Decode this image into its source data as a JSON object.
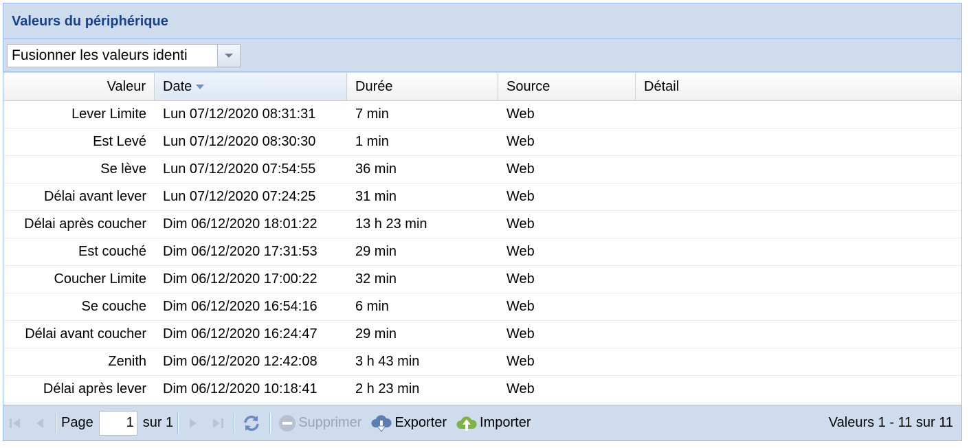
{
  "panel": {
    "title": "Valeurs du périphérique"
  },
  "combo": {
    "value": "Fusionner les valeurs identi"
  },
  "columns": {
    "valeur": "Valeur",
    "date": "Date",
    "duree": "Durée",
    "source": "Source",
    "detail": "Détail"
  },
  "rows": [
    {
      "valeur": "Lever Limite",
      "date": "Lun 07/12/2020 08:31:31",
      "duree": "7 min",
      "source": "Web",
      "detail": ""
    },
    {
      "valeur": "Est Levé",
      "date": "Lun 07/12/2020 08:30:30",
      "duree": "1 min",
      "source": "Web",
      "detail": ""
    },
    {
      "valeur": "Se lève",
      "date": "Lun 07/12/2020 07:54:55",
      "duree": "36 min",
      "source": "Web",
      "detail": ""
    },
    {
      "valeur": "Délai avant lever",
      "date": "Lun 07/12/2020 07:24:25",
      "duree": "31 min",
      "source": "Web",
      "detail": ""
    },
    {
      "valeur": "Délai après coucher",
      "date": "Dim 06/12/2020 18:01:22",
      "duree": "13 h 23 min",
      "source": "Web",
      "detail": ""
    },
    {
      "valeur": "Est couché",
      "date": "Dim 06/12/2020 17:31:53",
      "duree": "29 min",
      "source": "Web",
      "detail": ""
    },
    {
      "valeur": "Coucher Limite",
      "date": "Dim 06/12/2020 17:00:22",
      "duree": "32 min",
      "source": "Web",
      "detail": ""
    },
    {
      "valeur": "Se couche",
      "date": "Dim 06/12/2020 16:54:16",
      "duree": "6 min",
      "source": "Web",
      "detail": ""
    },
    {
      "valeur": "Délai avant coucher",
      "date": "Dim 06/12/2020 16:24:47",
      "duree": "29 min",
      "source": "Web",
      "detail": ""
    },
    {
      "valeur": "Zenith",
      "date": "Dim 06/12/2020 12:42:08",
      "duree": "3 h 43 min",
      "source": "Web",
      "detail": ""
    },
    {
      "valeur": "Délai après lever",
      "date": "Dim 06/12/2020 10:18:41",
      "duree": "2 h 23 min",
      "source": "Web",
      "detail": ""
    }
  ],
  "paging": {
    "page_label": "Page",
    "page_value": "1",
    "of_label": "sur 1",
    "delete_label": "Supprimer",
    "export_label": "Exporter",
    "import_label": "Importer",
    "display_info": "Valeurs 1 - 11 sur 11"
  },
  "colors": {
    "panel_bg": "#cfdcee",
    "border": "#99bbe8",
    "title": "#15428b",
    "export_icon": "#5b7db1",
    "import_icon": "#7cb342",
    "disabled": "#9aa4b3"
  },
  "icons": {
    "first": "first-page-icon",
    "prev": "prev-page-icon",
    "next": "next-page-icon",
    "last": "last-page-icon",
    "refresh": "refresh-icon",
    "delete": "minus-circle-icon",
    "export": "cloud-download-icon",
    "import": "cloud-upload-icon"
  }
}
